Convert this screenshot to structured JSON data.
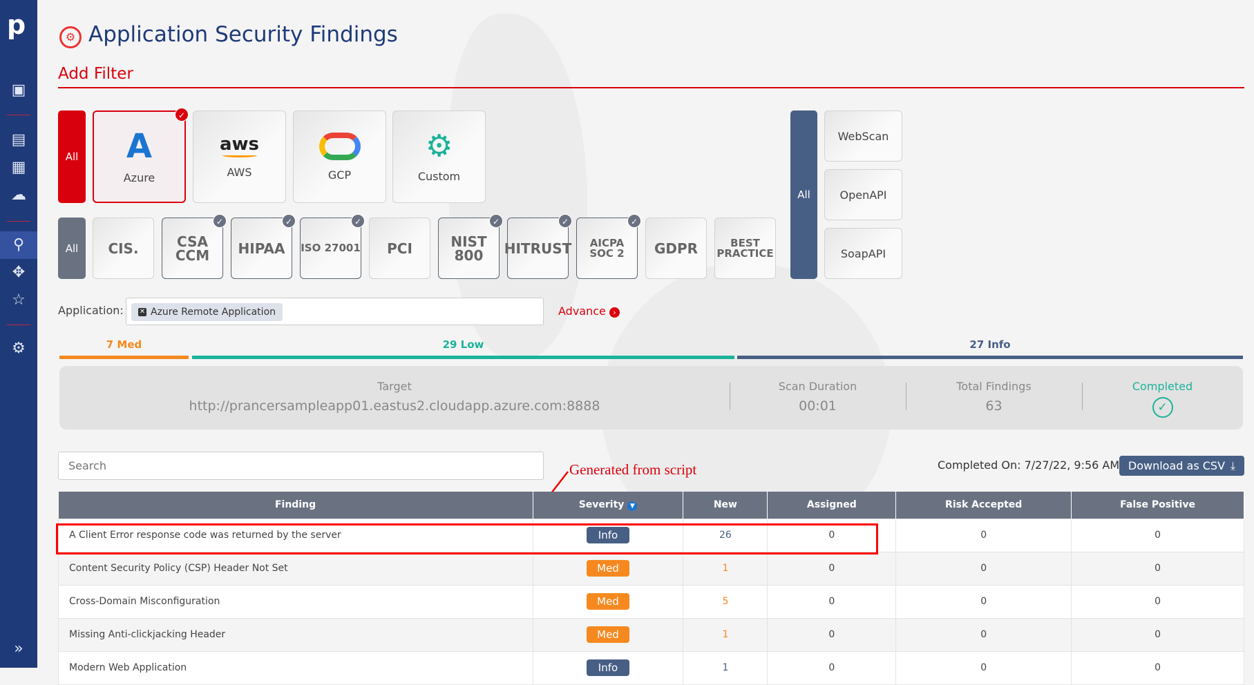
{
  "sidebar": {
    "logo": "p",
    "icons": [
      "monitor-dashboard-icon",
      "report-icon",
      "settings-doc-icon",
      "cloud-search-icon",
      "security-search-icon",
      "move-arrows-icon",
      "star-grid-icon",
      "users-gear-icon"
    ],
    "expand": "»"
  },
  "header": {
    "title": "Application Security Findings",
    "add_filter": "Add Filter"
  },
  "clouds": {
    "all": "All",
    "items": [
      {
        "label": "Azure",
        "selected": true
      },
      {
        "label": "AWS",
        "logo": "aws"
      },
      {
        "label": "GCP"
      },
      {
        "label": "Custom"
      }
    ]
  },
  "compliance": {
    "all": "All",
    "items": [
      {
        "logo": "CIS.",
        "checked": false
      },
      {
        "logo": "CSA CCM",
        "checked": true
      },
      {
        "logo": "HIPAA",
        "checked": true
      },
      {
        "logo": "ISO 27001",
        "checked": true
      },
      {
        "logo": "PCI",
        "checked": false
      },
      {
        "logo": "NIST 800",
        "checked": true
      },
      {
        "logo": "HITRUST",
        "checked": true
      },
      {
        "logo": "AICPA SOC 2",
        "checked": true
      },
      {
        "logo": "GDPR",
        "checked": false
      },
      {
        "logo": "BEST PRACTICE",
        "checked": false
      }
    ]
  },
  "scan_types": {
    "all": "All",
    "items": [
      "WebScan",
      "OpenAPI",
      "SoapAPI"
    ]
  },
  "application": {
    "label": "Application:",
    "chip": "Azure Remote Application",
    "advance": "Advance"
  },
  "severity_bar": {
    "med": "7 Med",
    "low": "29 Low",
    "info": "27 Info",
    "colors": {
      "med": "#f5891f",
      "low": "#1bb39a",
      "info": "#475f85"
    }
  },
  "summary": {
    "target_label": "Target",
    "target": "http://prancersampleapp01.eastus2.cloudapp.azure.com:8888",
    "duration_label": "Scan Duration",
    "duration": "00:01",
    "total_label": "Total Findings",
    "total": "63",
    "status": "Completed"
  },
  "search": {
    "placeholder": "Search"
  },
  "completed_on": "Completed On: 7/27/22, 9:56 AM",
  "download": "Download as CSV",
  "annotation": "Generated from script",
  "table": {
    "headers": [
      "Finding",
      "Severity",
      "New",
      "Assigned",
      "Risk Accepted",
      "False Positive"
    ],
    "rows": [
      {
        "finding": "A Client Error response code was returned by the server",
        "severity": "Info",
        "new": "26",
        "assigned": "0",
        "risk": "0",
        "fp": "0"
      },
      {
        "finding": "Content Security Policy (CSP) Header Not Set",
        "severity": "Med",
        "new": "1",
        "assigned": "0",
        "risk": "0",
        "fp": "0"
      },
      {
        "finding": "Cross-Domain Misconfiguration",
        "severity": "Med",
        "new": "5",
        "assigned": "0",
        "risk": "0",
        "fp": "0"
      },
      {
        "finding": "Missing Anti-clickjacking Header",
        "severity": "Med",
        "new": "1",
        "assigned": "0",
        "risk": "0",
        "fp": "0"
      },
      {
        "finding": "Modern Web Application",
        "severity": "Info",
        "new": "1",
        "assigned": "0",
        "risk": "0",
        "fp": "0"
      }
    ]
  }
}
